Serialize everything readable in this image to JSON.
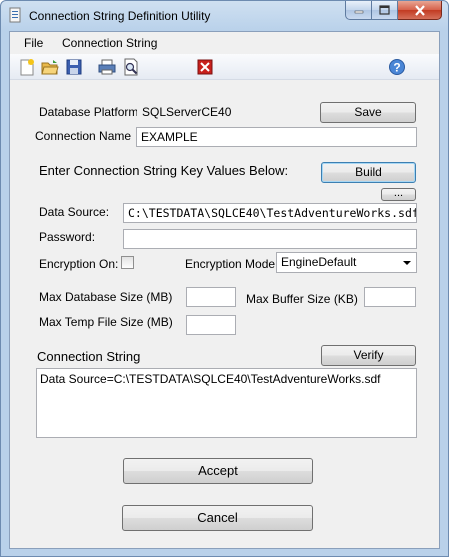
{
  "window": {
    "title": "Connection String Definition Utility"
  },
  "menu": {
    "items": [
      "File",
      "Connection String"
    ]
  },
  "form": {
    "platform_label": "Database Platform",
    "platform_value": "SQLServerCE40",
    "save_label": "Save",
    "conn_name_label": "Connection Name",
    "conn_name_value": "EXAMPLE",
    "enter_keys_label": "Enter Connection String Key Values Below:",
    "build_label": "Build",
    "browse_label": "...",
    "data_source_label": "Data Source:",
    "data_source_value": "C:\\TESTDATA\\SQLCE40\\TestAdventureWorks.sdf",
    "password_label": "Password:",
    "password_value": "",
    "encryption_on_label": "Encryption On:",
    "encryption_on_checked": false,
    "encryption_mode_label": "Encryption Mode:",
    "encryption_mode_value": "EngineDefault",
    "max_db_size_label": "Max Database Size (MB)",
    "max_db_size_value": "",
    "max_buffer_size_label": "Max Buffer Size (KB)",
    "max_buffer_size_value": "",
    "max_temp_size_label": "Max Temp File Size (MB)",
    "max_temp_size_value": "",
    "conn_string_label": "Connection String",
    "verify_label": "Verify",
    "conn_string_value": "Data Source=C:\\TESTDATA\\SQLCE40\\TestAdventureWorks.sdf",
    "accept_label": "Accept",
    "cancel_label": "Cancel"
  },
  "toolbar_icons": [
    "new-file-icon",
    "open-folder-icon",
    "save-disk-icon",
    "print-icon",
    "print-preview-icon",
    "exit-icon",
    "help-icon"
  ]
}
